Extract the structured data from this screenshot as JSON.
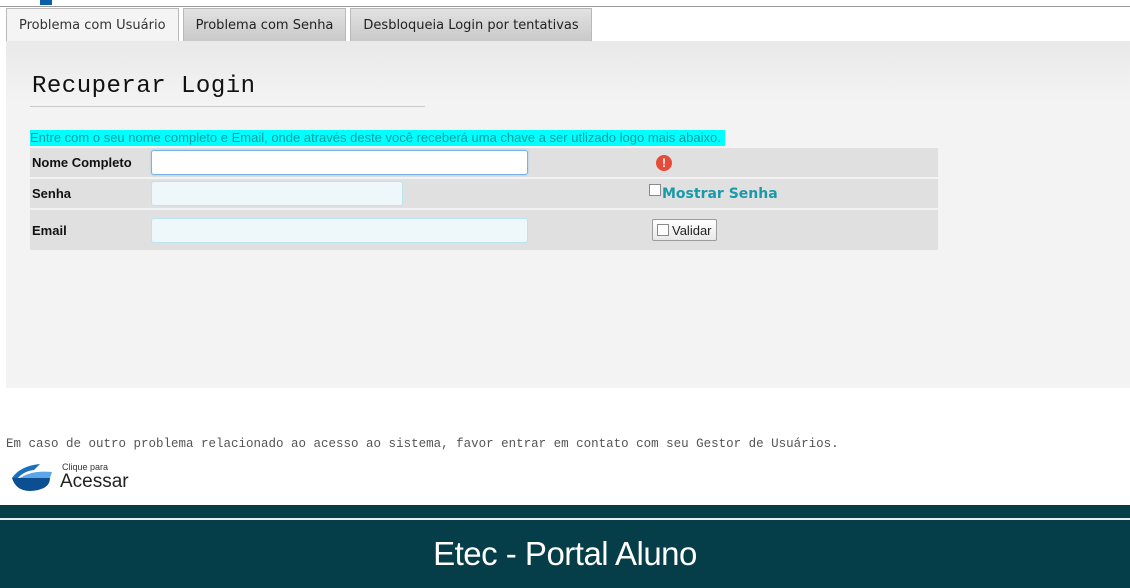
{
  "tabs": [
    {
      "label": "Problema com Usuário",
      "active": true
    },
    {
      "label": "Problema com Senha",
      "active": false
    },
    {
      "label": "Desbloqueia Login por tentativas",
      "active": false
    }
  ],
  "form": {
    "title": "Recuperar Login",
    "instruction": "Entre com o seu nome completo e Email, onde através deste você receberá uma chave a ser utlizado logo mais abaixo.",
    "fields": {
      "nome": {
        "label": "Nome Completo",
        "value": "",
        "placeholder": ""
      },
      "senha": {
        "label": "Senha",
        "value": "",
        "placeholder": ""
      },
      "email": {
        "label": "Email",
        "value": "",
        "placeholder": ""
      }
    },
    "show_password_label": "Mostrar Senha",
    "validate_label": "Validar",
    "error_icon": "!"
  },
  "contact_note": "Em caso de outro problema relacionado ao acesso ao sistema, favor entrar em contato com seu Gestor de Usuários.",
  "access_button": {
    "small": "Clique para",
    "big": "Acessar"
  },
  "footer": {
    "title": "Etec - Portal Aluno"
  },
  "colors": {
    "footer_bg": "#053e49",
    "instruction_bg": "#00ffff",
    "instruction_text": "#009f9f",
    "error": "#e64a3b",
    "accent": "#1a9aa8"
  }
}
